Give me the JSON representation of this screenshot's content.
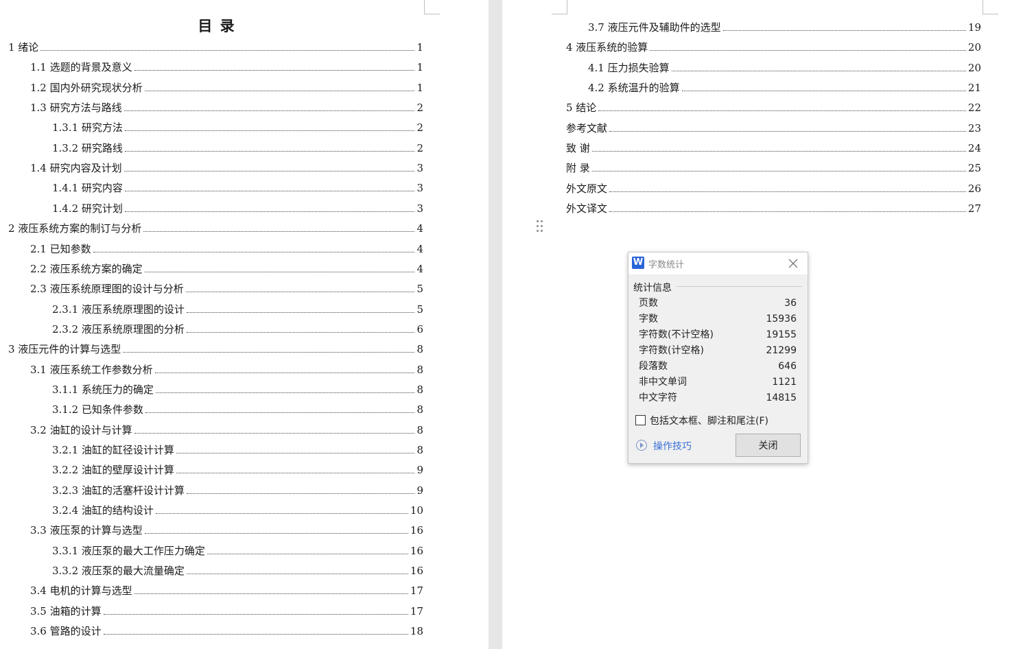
{
  "left_page": {
    "title": "目  录",
    "entries": [
      {
        "label": "1 绪论",
        "page": "1"
      },
      {
        "label": "1.1 选题的背景及意义",
        "page": "1"
      },
      {
        "label": "1.2 国内外研究现状分析",
        "page": "1"
      },
      {
        "label": "1.3 研究方法与路线",
        "page": "2"
      },
      {
        "label": "1.3.1 研究方法",
        "page": "2"
      },
      {
        "label": "1.3.2 研究路线",
        "page": "2"
      },
      {
        "label": "1.4 研究内容及计划",
        "page": "3"
      },
      {
        "label": "1.4.1 研究内容",
        "page": "3"
      },
      {
        "label": "1.4.2 研究计划",
        "page": "3"
      },
      {
        "label": "2 液压系统方案的制订与分析",
        "page": "4"
      },
      {
        "label": "2.1 已知参数",
        "page": "4"
      },
      {
        "label": "2.2 液压系统方案的确定",
        "page": "4"
      },
      {
        "label": "2.3 液压系统原理图的设计与分析",
        "page": "5"
      },
      {
        "label": "2.3.1 液压系统原理图的设计",
        "page": "5"
      },
      {
        "label": "2.3.2 液压系统原理图的分析",
        "page": "6"
      },
      {
        "label": "3  液压元件的计算与选型",
        "page": "8"
      },
      {
        "label": "3.1 液压系统工作参数分析",
        "page": "8"
      },
      {
        "label": "3.1.1 系统压力的确定",
        "page": "8"
      },
      {
        "label": "3.1.2 已知条件参数",
        "page": "8"
      },
      {
        "label": "3.2 油缸的设计与计算",
        "page": "8"
      },
      {
        "label": "3.2.1 油缸的缸径设计计算",
        "page": "8"
      },
      {
        "label": "3.2.2 油缸的壁厚设计计算",
        "page": "9"
      },
      {
        "label": "3.2.3 油缸的活塞杆设计计算",
        "page": "9"
      },
      {
        "label": "3.2.4 油缸的结构设计",
        "page": "10"
      },
      {
        "label": "3.3 液压泵的计算与选型",
        "page": "16"
      },
      {
        "label": "3.3.1 液压泵的最大工作压力确定",
        "page": "16"
      },
      {
        "label": "3.3.2 液压泵的最大流量确定",
        "page": "16"
      },
      {
        "label": "3.4 电机的计算与选型",
        "page": "17"
      },
      {
        "label": "3.5 油箱的计算",
        "page": "17"
      },
      {
        "label": "3.6 管路的设计",
        "page": "18"
      }
    ]
  },
  "right_page": {
    "entries": [
      {
        "label": "3.7 液压元件及辅助件的选型",
        "page": "19"
      },
      {
        "label": "4 液压系统的验算",
        "page": "20"
      },
      {
        "label": "4.1 压力损失验算",
        "page": "20"
      },
      {
        "label": "4.2 系统温升的验算",
        "page": "21"
      },
      {
        "label": "5 结论",
        "page": "22"
      },
      {
        "label": "参考文献",
        "page": "23"
      },
      {
        "label": "致  谢",
        "page": "24"
      },
      {
        "label": "附  录",
        "page": "25"
      },
      {
        "label": "外文原文",
        "page": "26"
      },
      {
        "label": "外文译文",
        "page": "27"
      }
    ]
  },
  "dialog": {
    "logo_text": "W",
    "title": "字数统计",
    "section_label": "统计信息",
    "stats": [
      {
        "label": "页数",
        "value": "36"
      },
      {
        "label": "字数",
        "value": "15936"
      },
      {
        "label": "字符数(不计空格)",
        "value": "19155"
      },
      {
        "label": "字符数(计空格)",
        "value": "21299"
      },
      {
        "label": "段落数",
        "value": "646"
      },
      {
        "label": "非中文单词",
        "value": "1121"
      },
      {
        "label": "中文字符",
        "value": "14815"
      }
    ],
    "include_checkbox_label": "包括文本框、脚注和尾注(F)",
    "tips_label": "操作技巧",
    "close_label": "关闭"
  }
}
